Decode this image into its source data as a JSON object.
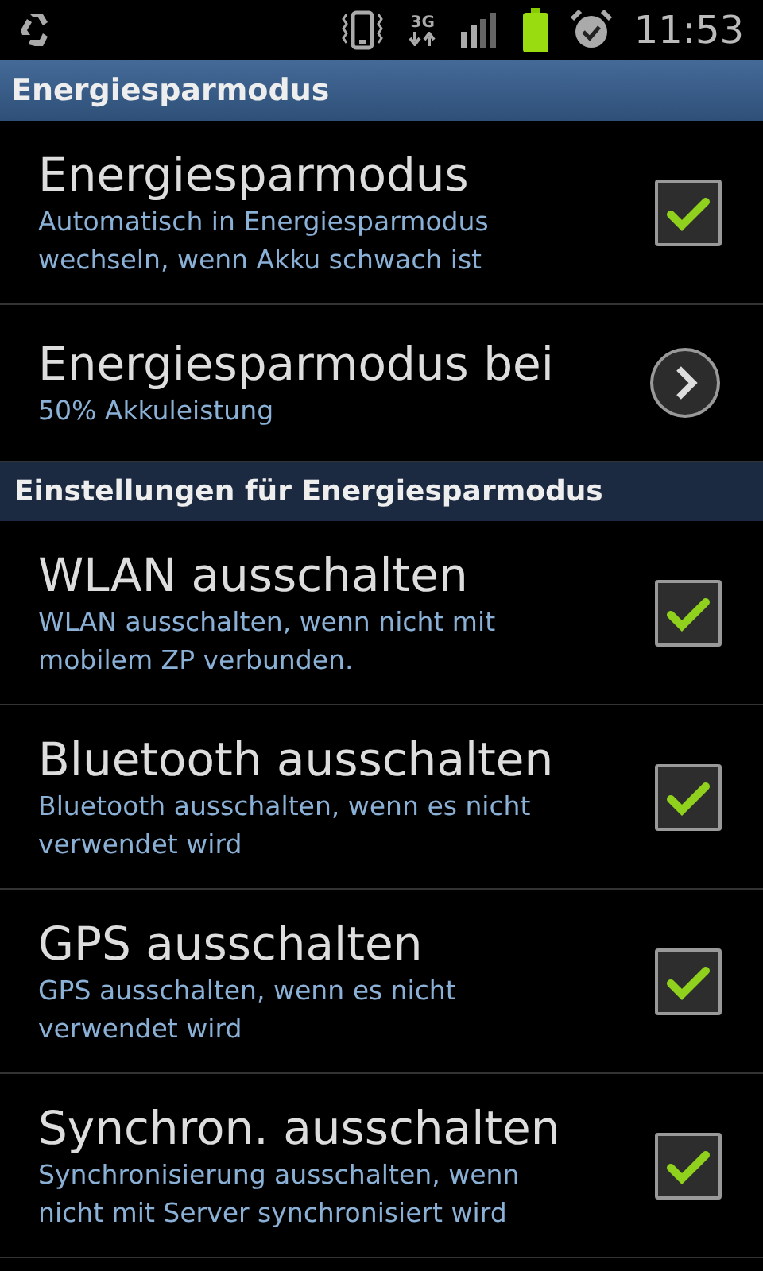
{
  "status_bar": {
    "network_type": "3G",
    "time": "11:53"
  },
  "title_bar": {
    "title": "Energiesparmodus"
  },
  "sections": [
    {
      "items": [
        {
          "kind": "checkbox",
          "title": "Energiesparmodus",
          "summary": "Automatisch in Energiesparmodus wechseln, wenn Akku schwach ist",
          "checked": true
        },
        {
          "kind": "link",
          "title": "Energiesparmodus bei",
          "summary": "50% Akkuleistung"
        }
      ]
    },
    {
      "header": "Einstellungen für Energiesparmodus",
      "items": [
        {
          "kind": "checkbox",
          "title": "WLAN ausschalten",
          "summary": "WLAN ausschalten, wenn nicht mit mobilem ZP verbunden.",
          "checked": true
        },
        {
          "kind": "checkbox",
          "title": "Bluetooth ausschalten",
          "summary": "Bluetooth ausschalten, wenn es nicht verwendet wird",
          "checked": true
        },
        {
          "kind": "checkbox",
          "title": "GPS ausschalten",
          "summary": "GPS ausschalten, wenn es nicht verwendet wird",
          "checked": true
        },
        {
          "kind": "checkbox",
          "title": "Synchron. ausschalten",
          "summary": "Synchronisierung ausschalten, wenn nicht mit Server synchronisiert wird",
          "checked": true
        }
      ]
    }
  ]
}
